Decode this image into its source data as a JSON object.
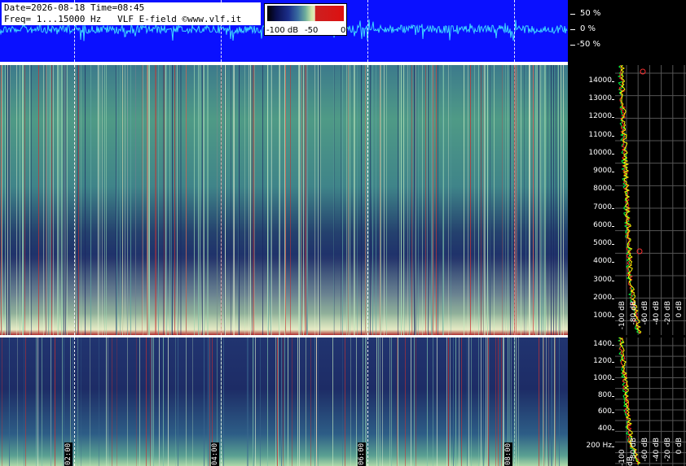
{
  "header": {
    "date_line": "Date=2026-08-18 Time=08:45",
    "freq_line": "Freq= 1...15000 Hz   VLF E-field ©www.vlf.it"
  },
  "colorbar": {
    "labels": [
      "-100 dB",
      "-50",
      "0"
    ]
  },
  "waveform_scale": [
    "50 %",
    "0 %",
    "-50 %"
  ],
  "time_labels": [
    "02:00",
    "04:00",
    "06:00",
    "08:00"
  ],
  "upper_freq_labels": [
    "14000",
    "13000",
    "12000",
    "11000",
    "10000",
    "9000",
    "8000",
    "7000",
    "6000",
    "5000",
    "4000",
    "3000",
    "2000",
    "1000"
  ],
  "lower_freq_labels": [
    "1400",
    "1200",
    "1000",
    "800",
    "600",
    "400",
    "200 Hz"
  ],
  "db_labels": [
    "-100 dB",
    "-80 dB",
    "-60 dB",
    "-40 dB",
    "-20 dB",
    "0 dB"
  ],
  "colors": {
    "waveform_bg": "#0a10ff",
    "waveform_trace": "#3fd7ff",
    "profile_line_1": "#ffff00",
    "profile_line_2": "#ff2020",
    "profile_line_3": "#00ff40"
  }
}
